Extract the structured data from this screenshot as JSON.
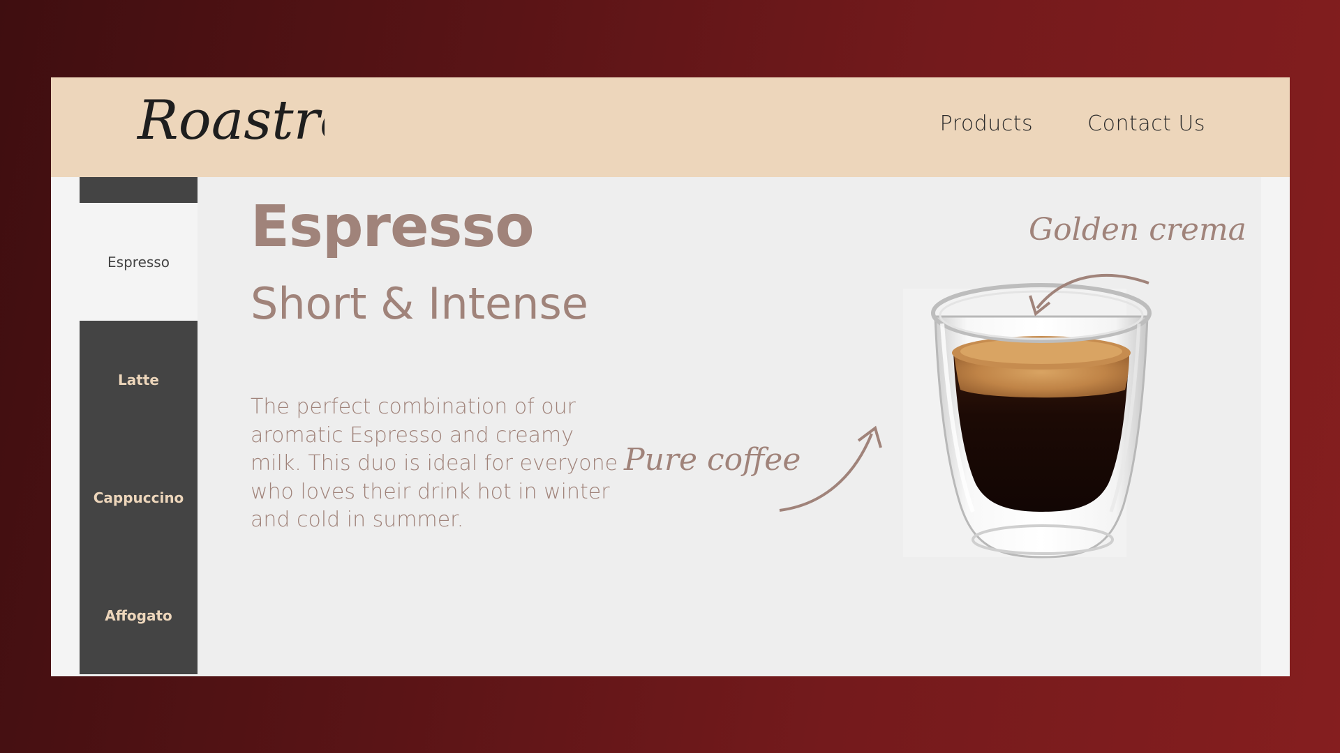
{
  "brand": {
    "logo_text": "Roastro"
  },
  "nav": {
    "products_label": "Products",
    "contact_label": "Contact Us"
  },
  "sidebar": {
    "items": [
      {
        "label": "Espresso",
        "active": true
      },
      {
        "label": "Latte",
        "active": false
      },
      {
        "label": "Cappuccino",
        "active": false
      },
      {
        "label": "Affogato",
        "active": false
      }
    ]
  },
  "product": {
    "title": "Espresso",
    "subtitle": "Short & Intense",
    "description": "The perfect combination of our aromatic Espresso and creamy milk. This duo is ideal for everyone who loves their drink hot in winter and cold in summer.",
    "annotations": {
      "top": "Golden crema",
      "bottom": "Pure coffee"
    }
  },
  "colors": {
    "background_dark": "#4a1012",
    "background_red": "#851e1f",
    "header": "#edd6bb",
    "sidebar": "#444444",
    "accent_text": "#a0837a",
    "content_bg": "#eeeeee"
  },
  "icons": {
    "logo": "roastro-script-logo",
    "product_image": "espresso-glass",
    "arrow_top": "curved-arrow-icon",
    "arrow_bottom": "curved-arrow-icon"
  }
}
